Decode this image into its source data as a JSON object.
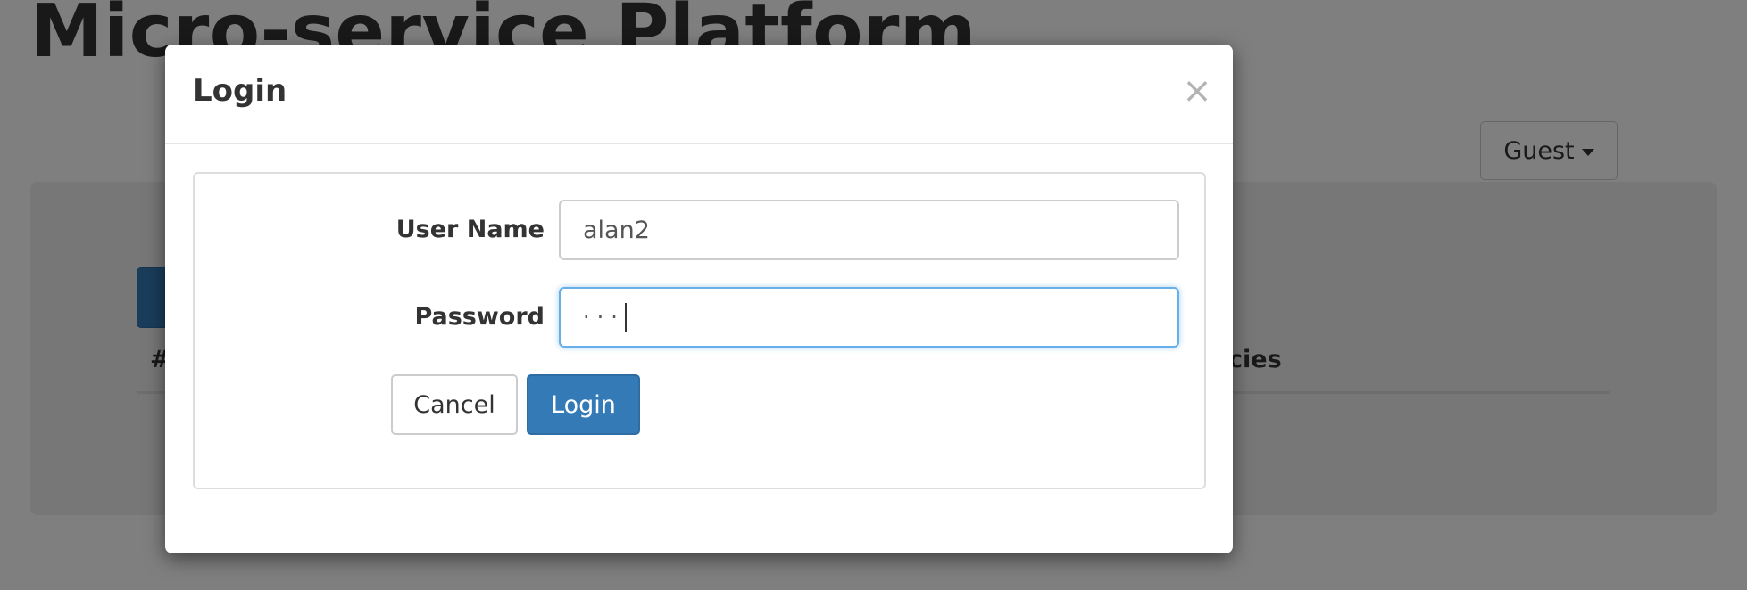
{
  "page": {
    "title": "Micro-service Platform",
    "user_menu": {
      "label": "Guest",
      "icon": "caret-down-icon"
    },
    "table": {
      "headers": [
        {
          "label": "#"
        },
        {
          "label": "cies"
        }
      ]
    }
  },
  "login_modal": {
    "title": "Login",
    "close_symbol": "×",
    "fields": {
      "username": {
        "label": "User Name",
        "value": "alan2"
      },
      "password": {
        "label": "Password",
        "masked_value": "···"
      }
    },
    "buttons": {
      "cancel": "Cancel",
      "submit": "Login"
    }
  },
  "colors": {
    "primary": "#337ab7",
    "focus_border": "#66afe9",
    "backdrop": "rgba(0,0,0,0.5)"
  }
}
